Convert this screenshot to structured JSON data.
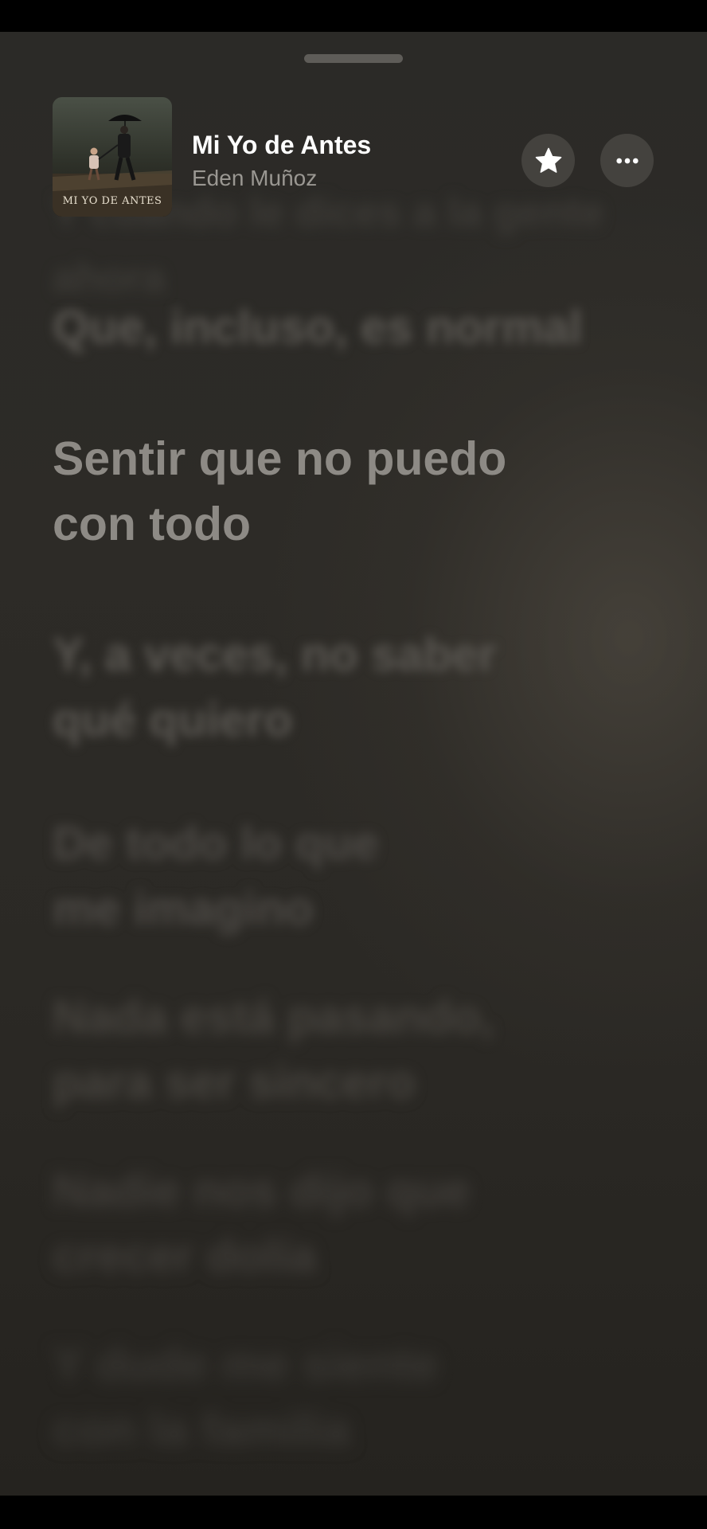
{
  "now_playing": {
    "title": "Mi Yo de Antes",
    "artist": "Eden Muñoz",
    "artwork_caption": "MI YO DE ANTES",
    "favorite_icon": "star-icon",
    "more_icon": "ellipsis-icon"
  },
  "lyrics": {
    "partial_top": "Y cuando le dices a la gente ahora",
    "lines": [
      {
        "text": "Que, incluso, es normal",
        "state": "past"
      },
      {
        "text": "Sentir que no puedo\ncon todo",
        "state": "current"
      },
      {
        "text": "Y, a veces, no saber\nqué quiero",
        "state": "upcoming"
      },
      {
        "text": "De todo lo que\nme imagino",
        "state": "upcoming"
      },
      {
        "text": "Nada está pasando,\npara ser sincero",
        "state": "upcoming"
      },
      {
        "text": "Nadie nos dijo que\ncrecer dolía",
        "state": "upcoming"
      },
      {
        "text": "Y dude me siente\ncon la familia",
        "state": "upcoming"
      }
    ]
  },
  "colors": {
    "background": "#2c2a26",
    "current_lyric": "#8d8a85",
    "title": "#ffffff",
    "artist": "#9a9792"
  }
}
